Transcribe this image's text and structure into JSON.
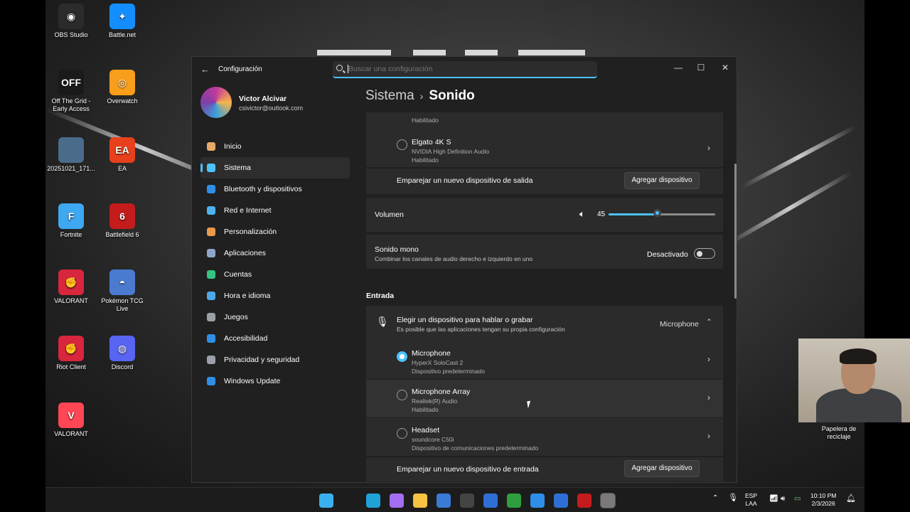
{
  "desktop": {
    "icons": [
      {
        "label": "OBS Studio",
        "color": "#2b2b2b",
        "glyph": "◉"
      },
      {
        "label": "Battle.net",
        "color": "#148eff",
        "glyph": "✦"
      },
      {
        "label": "Off The Grid - Early Access",
        "color": "#1a1a1a",
        "glyph": "OFF"
      },
      {
        "label": "Overwatch",
        "color": "#f99e1a",
        "glyph": "◎"
      },
      {
        "label": "20251021_171...",
        "color": "#4a6b8a",
        "glyph": ""
      },
      {
        "label": "EA",
        "color": "#e8401c",
        "glyph": "EA"
      },
      {
        "label": "Fortnite",
        "color": "#3ea8f0",
        "glyph": "F"
      },
      {
        "label": "Battlefield 6",
        "color": "#c41c1c",
        "glyph": "6"
      },
      {
        "label": "VALORANT",
        "color": "#d7263d",
        "glyph": "✊"
      },
      {
        "label": "Pokémon TCG Live",
        "color": "#4a7bd0",
        "glyph": "◓"
      },
      {
        "label": "Riot Client",
        "color": "#d7263d",
        "glyph": "✊"
      },
      {
        "label": "Discord",
        "color": "#5865f2",
        "glyph": "◍"
      },
      {
        "label": "VALORANT",
        "color": "#ff4655",
        "glyph": "V"
      }
    ],
    "recycle_bin_label": "Papelera de reciclaje"
  },
  "window": {
    "app_title": "Configuración",
    "search_placeholder": "Buscar una configuración",
    "controls": {
      "minimize": "—",
      "maximize": "☐",
      "close": "✕"
    }
  },
  "profile": {
    "name": "Victor Alcivar",
    "email": "csivictor@outlook.com"
  },
  "nav": {
    "items": [
      {
        "label": "Inicio",
        "color": "#e8a86a"
      },
      {
        "label": "Sistema",
        "color": "#4cc2ff"
      },
      {
        "label": "Bluetooth y dispositivos",
        "color": "#2f8ee8"
      },
      {
        "label": "Red e Internet",
        "color": "#4cb3f0"
      },
      {
        "label": "Personalización",
        "color": "#e89a4c"
      },
      {
        "label": "Aplicaciones",
        "color": "#8fa6c8"
      },
      {
        "label": "Cuentas",
        "color": "#33c481"
      },
      {
        "label": "Hora e idioma",
        "color": "#4ca8e8"
      },
      {
        "label": "Juegos",
        "color": "#9aa0a6"
      },
      {
        "label": "Accesibilidad",
        "color": "#2f8ee8"
      },
      {
        "label": "Privacidad y seguridad",
        "color": "#9aa0a6"
      },
      {
        "label": "Windows Update",
        "color": "#2f8ee8"
      }
    ]
  },
  "breadcrumb": {
    "parent": "Sistema",
    "separator": "›",
    "current": "Sonido"
  },
  "output": {
    "prev_device_status": "Habilitado",
    "device": {
      "name": "Elgato 4K S",
      "driver": "NVIDIA High Definition Audio",
      "status": "Habilitado"
    },
    "pair_label": "Emparejar un nuevo dispositivo de salida",
    "add_button": "Agregar dispositivo"
  },
  "volume": {
    "label": "Volumen",
    "value": "45",
    "fraction": 0.45
  },
  "mono": {
    "label": "Sonido mono",
    "description": "Combinar los canales de audio derecho e izquierdo en uno",
    "state": "Desactivado"
  },
  "input": {
    "section_title": "Entrada",
    "chooser": {
      "title": "Elegir un dispositivo para hablar o grabar",
      "description": "Es posible que las aplicaciones tengan su propia configuración",
      "selected": "Microphone"
    },
    "devices": [
      {
        "name": "Microphone",
        "driver": "HyperX SoloCast 2",
        "status": "Dispositivo predeterminado",
        "selected": true
      },
      {
        "name": "Microphone Array",
        "driver": "Realtek(R) Audio",
        "status": "Habilitado",
        "selected": false
      },
      {
        "name": "Headset",
        "driver": "soundcore C50i",
        "status": "Dispositivo de comunicaciones predeterminado",
        "selected": false
      }
    ],
    "pair_label": "Emparejar un nuevo dispositivo de entrada",
    "add_button": "Agregar dispositivo"
  },
  "taskbar": {
    "language": "ESP",
    "layout": "LAA",
    "time": "10:10 PM",
    "date": "2/3/2026",
    "apps": [
      {
        "name": "start",
        "color": "#3ab0f0"
      },
      {
        "name": "search",
        "color": "#1c1c1c"
      },
      {
        "name": "edge",
        "color": "#1fa2d8"
      },
      {
        "name": "copilot",
        "color": "#a46ef0"
      },
      {
        "name": "explorer",
        "color": "#f5c242"
      },
      {
        "name": "store",
        "color": "#3a7bd5"
      },
      {
        "name": "chatgpt",
        "color": "#444"
      },
      {
        "name": "outlook",
        "color": "#2f6fd5"
      },
      {
        "name": "xbox",
        "color": "#2e9e3e"
      },
      {
        "name": "photos",
        "color": "#2f8ee8"
      },
      {
        "name": "mail",
        "color": "#2f6fd5"
      },
      {
        "name": "battlefield",
        "color": "#c41c1c"
      },
      {
        "name": "settings",
        "color": "#7a7a7a"
      }
    ]
  }
}
